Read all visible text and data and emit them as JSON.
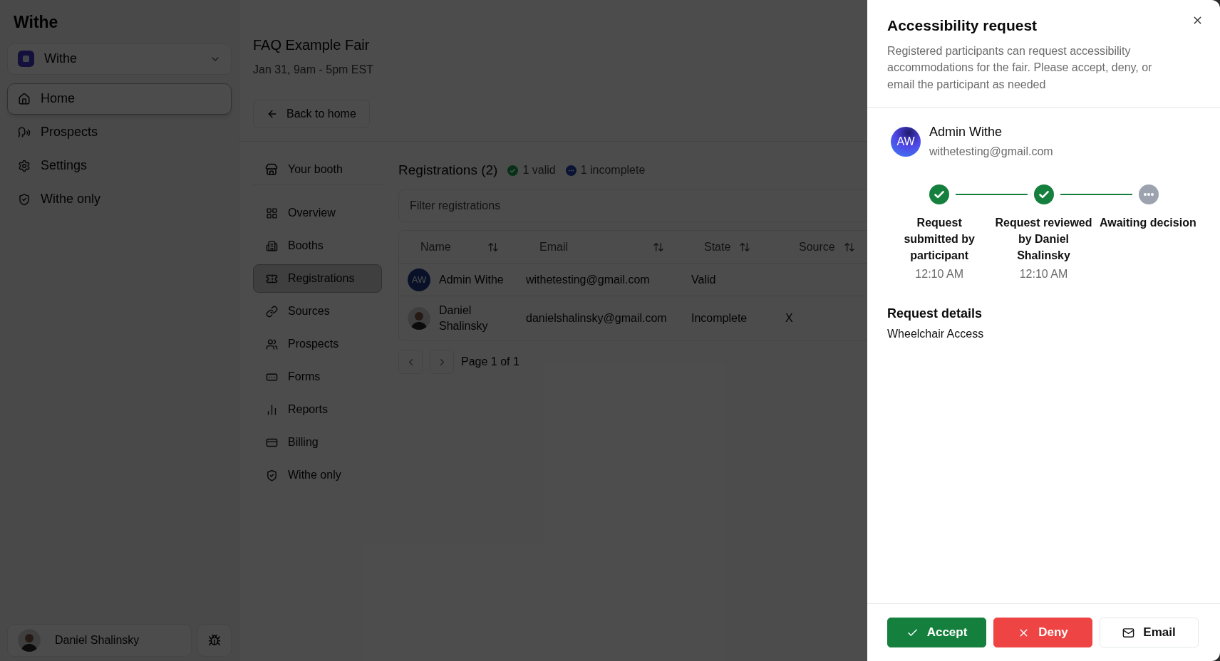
{
  "sidebar": {
    "app_title": "Withe",
    "workspace": {
      "name": "Withe"
    },
    "items": [
      {
        "label": "Home",
        "selected": true
      },
      {
        "label": "Prospects",
        "selected": false
      },
      {
        "label": "Settings",
        "selected": false
      },
      {
        "label": "Withe only",
        "selected": false
      }
    ],
    "user": {
      "name": "Daniel Shalinsky"
    }
  },
  "event": {
    "title": "FAQ Example Fair",
    "date": "Jan 31, 9am - 5pm EST",
    "back_button": "Back to home"
  },
  "booth_nav": {
    "header": "Your booth",
    "items": [
      {
        "label": "Overview",
        "selected": false
      },
      {
        "label": "Booths",
        "selected": false
      },
      {
        "label": "Registrations",
        "selected": true
      },
      {
        "label": "Sources",
        "selected": false
      },
      {
        "label": "Prospects",
        "selected": false
      },
      {
        "label": "Forms",
        "selected": false
      },
      {
        "label": "Reports",
        "selected": false
      },
      {
        "label": "Billing",
        "selected": false
      },
      {
        "label": "Withe only",
        "selected": false
      }
    ]
  },
  "registrations": {
    "title": "Registrations (2)",
    "summary": [
      {
        "kind": "valid",
        "label": "1 valid"
      },
      {
        "kind": "incomplete",
        "label": "1 incomplete"
      }
    ],
    "filter": {
      "placeholder": "Filter registrations"
    },
    "columns": [
      "Name",
      "Email",
      "State",
      "Source"
    ],
    "rows": [
      {
        "avatar": {
          "kind": "initials",
          "text": "AW"
        },
        "name": "Admin Withe",
        "email": "withetesting@gmail.com",
        "state": "Valid"
      },
      {
        "avatar": {
          "kind": "photo"
        },
        "name": "Daniel Shalinsky",
        "email": "danielshalinsky@gmail.com",
        "state": "Incomplete",
        "source": "X"
      }
    ],
    "pagination": "Page 1 of 1"
  },
  "panel": {
    "title": "Accessibility request",
    "description": "Registered participants can request accessibility accommodations for the fair. Please accept, deny, or email the participant as needed",
    "participant": {
      "initials": "AW",
      "name": "Admin Withe",
      "email": "withetesting@gmail.com"
    },
    "steps": [
      {
        "completed": true,
        "label": "Request submitted by participant",
        "time": "12:10 AM"
      },
      {
        "completed": true,
        "label": "Request reviewed by Daniel Shalinsky",
        "time": "12:10 AM"
      },
      {
        "completed": false,
        "label": "Awaiting decision"
      }
    ],
    "details": {
      "heading": "Request details",
      "value": "Wheelchair Access"
    },
    "buttons": [
      {
        "kind": "accept",
        "label": "Accept"
      },
      {
        "kind": "deny",
        "label": "Deny"
      },
      {
        "kind": "email",
        "label": "Email"
      }
    ]
  }
}
